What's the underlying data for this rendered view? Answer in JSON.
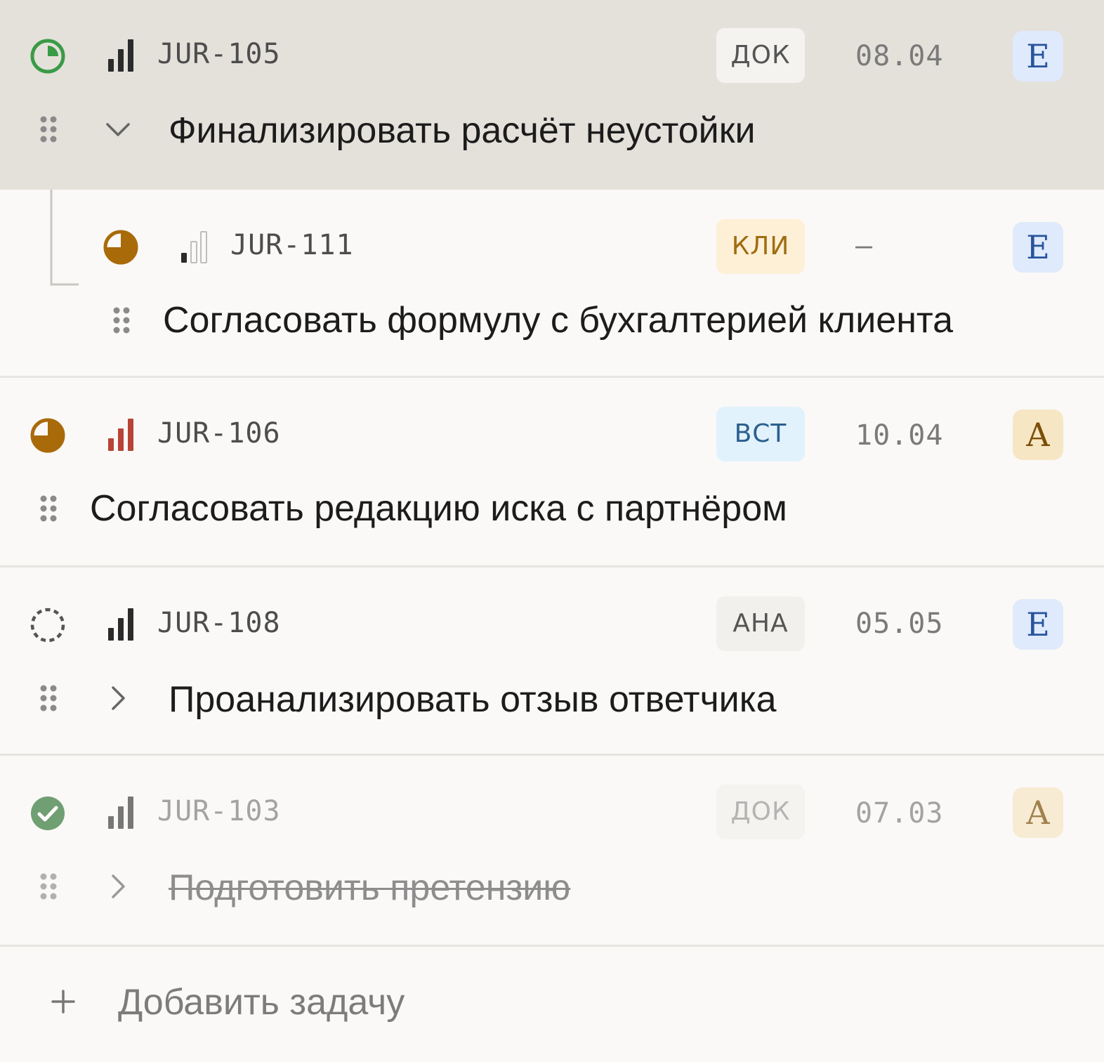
{
  "tasks": [
    {
      "key": "JUR-105",
      "tag": "ДОК",
      "date": "08.04",
      "assignee": "E",
      "title": "Финализировать расчёт неустойки",
      "status": "in-progress",
      "expanded": true
    },
    {
      "key": "JUR-111",
      "tag": "КЛИ",
      "date": "–",
      "assignee": "E",
      "title": "Согласовать формулу с бухгалтерией клиента",
      "status": "half-done",
      "subtask_of": "JUR-105"
    },
    {
      "key": "JUR-106",
      "tag": "ВСТ",
      "date": "10.04",
      "assignee": "A",
      "title": "Согласовать редакцию иска с партнёром",
      "status": "half-done",
      "priority": "urgent"
    },
    {
      "key": "JUR-108",
      "tag": "АНА",
      "date": "05.05",
      "assignee": "E",
      "title": "Проанализировать отзыв ответчика",
      "status": "todo",
      "expanded": false
    },
    {
      "key": "JUR-103",
      "tag": "ДОК",
      "date": "07.03",
      "assignee": "A",
      "title": "Подготовить претензию",
      "status": "done",
      "expanded": false
    }
  ],
  "add_task_label": "Добавить задачу",
  "colors": {
    "status_green": "#3a9b46",
    "status_amber": "#a96a0a",
    "status_done": "#6f9f72",
    "priority_dark": "#2b2b2b",
    "priority_urgent": "#b84336"
  },
  "icons": {
    "status": [
      "in-progress-icon",
      "half-done-icon",
      "todo-icon",
      "done-check-icon"
    ],
    "priority": [
      "priority-bars-icon",
      "priority-low-icon",
      "priority-urgent-icon"
    ],
    "other": [
      "drag-handle-icon",
      "chevron-down-icon",
      "chevron-right-icon",
      "plus-icon"
    ]
  }
}
